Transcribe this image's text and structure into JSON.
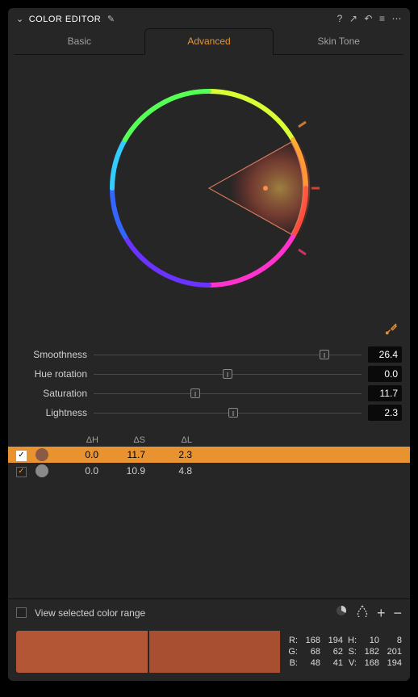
{
  "header": {
    "title": "COLOR EDITOR"
  },
  "tabs": {
    "basic": "Basic",
    "advanced": "Advanced",
    "skin": "Skin Tone"
  },
  "sliders": {
    "smoothness": {
      "label": "Smoothness",
      "value": "26.4",
      "pos": 86
    },
    "hue": {
      "label": "Hue rotation",
      "value": "0.0",
      "pos": 50
    },
    "saturation": {
      "label": "Saturation",
      "value": "11.7",
      "pos": 38
    },
    "lightness": {
      "label": "Lightness",
      "value": "2.3",
      "pos": 52
    }
  },
  "table": {
    "headers": {
      "dh": "ΔH",
      "ds": "ΔS",
      "dl": "ΔL"
    },
    "rows": [
      {
        "checked": true,
        "selected": true,
        "swatch": "#8a5a44",
        "dh": "0.0",
        "ds": "11.7",
        "dl": "2.3"
      },
      {
        "checked": true,
        "selected": false,
        "swatch": "#8a8a8a",
        "dh": "0.0",
        "ds": "10.9",
        "dl": "4.8"
      }
    ]
  },
  "footer": {
    "view_range": "View selected color range"
  },
  "swatches": {
    "left": "#b35636",
    "right": "#a84f32"
  },
  "colorvals": {
    "r_label": "R:",
    "r1": "168",
    "r2": "194",
    "g_label": "G:",
    "g1": "68",
    "g2": "62",
    "b_label": "B:",
    "b1": "48",
    "b2": "41",
    "h_label": "H:",
    "h1": "10",
    "h2": "8",
    "s_label": "S:",
    "s1": "182",
    "s2": "201",
    "v_label": "V:",
    "v1": "168",
    "v2": "194"
  }
}
